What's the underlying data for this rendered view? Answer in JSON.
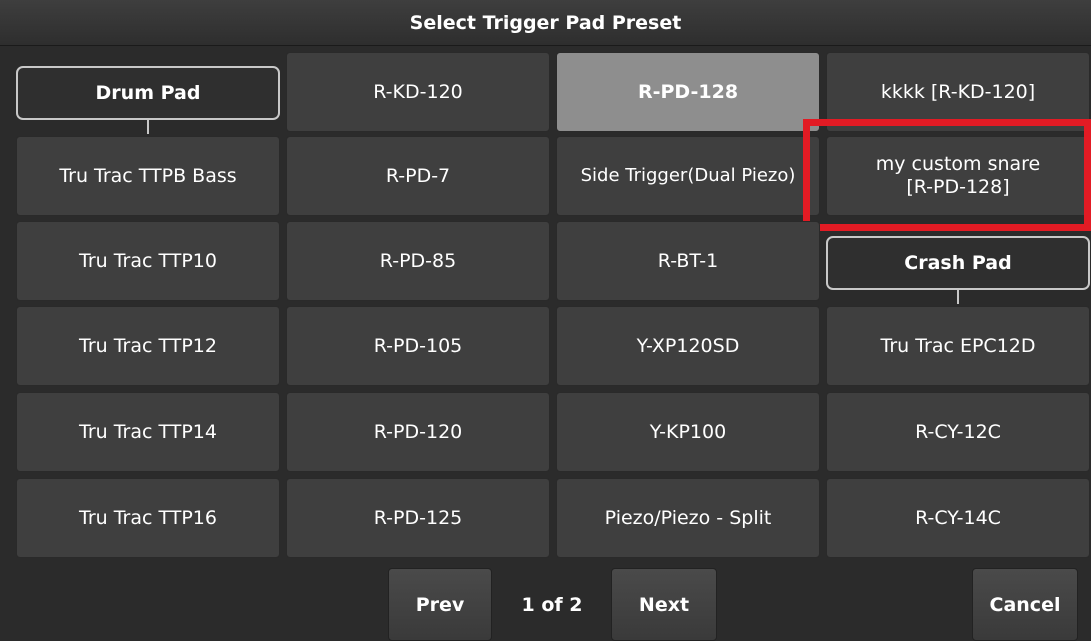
{
  "title": "Select Trigger Pad Preset",
  "groups": {
    "drum_pad": "Drum Pad",
    "crash_pad": "Crash Pad"
  },
  "pads": {
    "r_kd_120": "R-KD-120",
    "r_pd_128": "R-PD-128",
    "kkkk": "kkkk [R-KD-120]",
    "tru_trac_ttpb_bass": "Tru Trac TTPB Bass",
    "r_pd_7": "R-PD-7",
    "side_trigger": "Side Trigger(Dual Piezo)",
    "custom_snare_line1": "my custom snare",
    "custom_snare_line2": "[R-PD-128]",
    "tru_trac_ttp10": "Tru Trac TTP10",
    "r_pd_85": "R-PD-85",
    "r_bt_1": "R-BT-1",
    "tru_trac_ttp12": "Tru Trac TTP12",
    "r_pd_105": "R-PD-105",
    "y_xp120sd": "Y-XP120SD",
    "tru_trac_epc12d": "Tru Trac EPC12D",
    "tru_trac_ttp14": "Tru Trac TTP14",
    "r_pd_120": "R-PD-120",
    "y_kp100": "Y-KP100",
    "r_cy_12c": "R-CY-12C",
    "tru_trac_ttp16": "Tru Trac TTP16",
    "r_pd_125": "R-PD-125",
    "piezo_split": "Piezo/Piezo - Split",
    "r_cy_14c": "R-CY-14C"
  },
  "selected_pad": "R-PD-128",
  "footer": {
    "prev": "Prev",
    "page": "1 of 2",
    "next": "Next",
    "cancel": "Cancel"
  },
  "colors": {
    "background": "#2b2b2b",
    "pad": "#3f3f3f",
    "selected_pad": "#8e8e8e",
    "highlight": "#e21b24"
  }
}
